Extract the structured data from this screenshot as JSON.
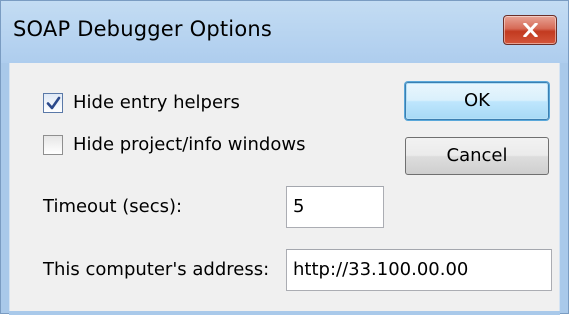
{
  "window": {
    "title": "SOAP Debugger Options"
  },
  "options": {
    "hide_entry_helpers": {
      "label": "Hide entry helpers",
      "checked": true
    },
    "hide_project_windows": {
      "label": "Hide project/info windows",
      "checked": false
    }
  },
  "buttons": {
    "ok_label": "OK",
    "cancel_label": "Cancel"
  },
  "fields": {
    "timeout": {
      "label": "Timeout (secs):",
      "value": "5"
    },
    "address": {
      "label": "This computer's address:",
      "value": "http://33.100.00.00"
    }
  },
  "icons": {
    "close": "close-icon",
    "check": "checkmark-icon"
  },
  "colors": {
    "close_button": "#c9452c",
    "default_button_border": "#3c7fb1",
    "title_bar": "#b7d3f0"
  }
}
